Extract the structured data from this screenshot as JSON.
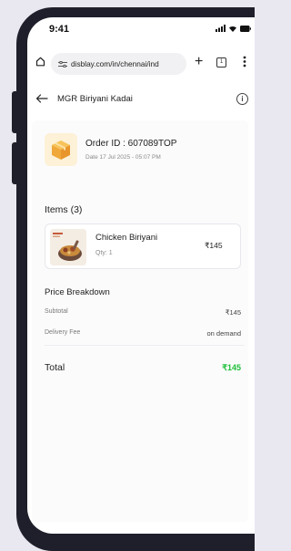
{
  "status_bar": {
    "time": "9:41",
    "icons": [
      "signal-icon",
      "wifi-icon",
      "battery-icon"
    ]
  },
  "browser": {
    "url": "disblay.com/in/chennai/ind",
    "tabs_count": "1"
  },
  "header": {
    "title": "MGR Biriyani Kadai"
  },
  "order": {
    "id_label": "Order ID : 607089TOP",
    "date": "Date 17 Jul 2025 - 05:07 PM"
  },
  "items": {
    "heading": "Items (3)",
    "list": [
      {
        "name": "Chicken Biriyani",
        "qty": "Qty: 1",
        "price": "₹145"
      }
    ]
  },
  "price_breakdown": {
    "heading": "Price Breakdown",
    "subtotal_label": "Subtotal",
    "subtotal_value": "₹145",
    "delivery_label": "Delivery Fee",
    "delivery_value": "on demand",
    "total_label": "Total",
    "total_value": "₹145"
  },
  "colors": {
    "accent_green": "#1fbf3a",
    "frame": "#1e1f2a",
    "background": "#e9e8f1"
  }
}
